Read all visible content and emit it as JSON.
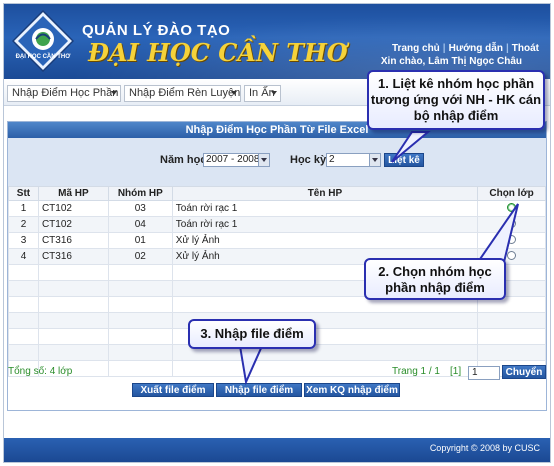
{
  "header": {
    "title_top": "QUẢN LÝ ĐÀO TẠO",
    "title_main": "ĐẠI HỌC CẦN THƠ",
    "logo_text": "ĐẠI HỌC CẦN THƠ",
    "links": [
      "Trang chủ",
      "Hướng dẫn",
      "Thoát"
    ],
    "greeting": "Xin chào, Lâm Thị Ngọc Châu"
  },
  "menu": [
    {
      "label": "Nhập Điểm Học Phần"
    },
    {
      "label": "Nhập Điểm Rèn Luyện"
    },
    {
      "label": "In Ấn"
    }
  ],
  "panel": {
    "title": "Nhập Điểm Học Phần Từ File Excel",
    "nam_hoc_label": "Năm học",
    "nam_hoc_value": "2007 - 2008",
    "hoc_ky_label": "Học kỳ",
    "hoc_ky_value": "2",
    "list_button": "Liệt kê"
  },
  "table": {
    "headers": [
      "Stt",
      "Mã HP",
      "Nhóm HP",
      "Tên HP",
      "Chọn lớp"
    ],
    "rows": [
      {
        "stt": "1",
        "ma": "CT102",
        "nhom": "03",
        "ten": "Toán rời rạc 1",
        "selected": true
      },
      {
        "stt": "2",
        "ma": "CT102",
        "nhom": "04",
        "ten": "Toán rời rạc 1",
        "selected": false
      },
      {
        "stt": "3",
        "ma": "CT316",
        "nhom": "01",
        "ten": "Xử lý Ảnh",
        "selected": false
      },
      {
        "stt": "4",
        "ma": "CT316",
        "nhom": "02",
        "ten": "Xử lý Ảnh",
        "selected": false
      }
    ]
  },
  "footer_info": {
    "total": "Tổng số: 4 lớp",
    "page": "Trang 1 / 1",
    "page_link": "[1]",
    "page_input": "1",
    "go_button": "Chuyển"
  },
  "actions": {
    "export": "Xuất file điểm",
    "import": "Nhập file điểm",
    "view": "Xem KQ nhập điểm"
  },
  "copyright": "Copyright © 2008 by CUSC",
  "callouts": {
    "c1": "1. Liệt kê nhóm học phần tương ứng với NH - HK cán bộ nhập điểm",
    "c2": "2. Chọn nhóm học phần nhập điểm",
    "c3": "3. Nhập file điểm"
  },
  "colors": {
    "header": "#2a64b8",
    "accent": "#f5d23a",
    "callout_border": "#2a2fb0",
    "status_green": "#2a8d2a"
  }
}
